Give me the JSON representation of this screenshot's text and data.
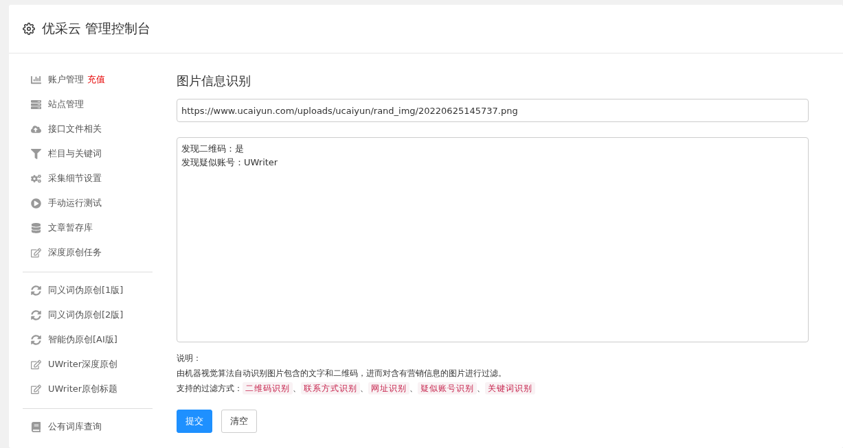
{
  "header": {
    "title": "优采云 管理控制台"
  },
  "sidebar": {
    "groups": [
      {
        "items": [
          {
            "label": "账户管理",
            "badge": "充值"
          },
          {
            "label": "站点管理"
          },
          {
            "label": "接口文件相关"
          },
          {
            "label": "栏目与关键词"
          },
          {
            "label": "采集细节设置"
          },
          {
            "label": "手动运行测试"
          },
          {
            "label": "文章暂存库"
          },
          {
            "label": "深度原创任务"
          }
        ]
      },
      {
        "items": [
          {
            "label": "同义词伪原创[1版]"
          },
          {
            "label": "同义词伪原创[2版]"
          },
          {
            "label": "智能伪原创[AI版]"
          },
          {
            "label": "UWriter深度原创"
          },
          {
            "label": "UWriter原创标题"
          }
        ]
      },
      {
        "items": [
          {
            "label": "公有词库查询"
          }
        ]
      }
    ]
  },
  "main": {
    "title": "图片信息识别",
    "url_field": {
      "value": "https://www.ucaiyun.com/uploads/ucaiyun/rand_img/20220625145737.png"
    },
    "result_box": {
      "lines": [
        "发现二维码：是",
        "发现疑似账号：UWriter"
      ]
    },
    "notes": {
      "heading": "说明：",
      "description": "由机器视觉算法自动识别图片包含的文字和二维码，进而对含有营销信息的图片进行过滤。",
      "methods_label": "支持的过滤方式：",
      "methods": [
        "二维码识别",
        "联系方式识别",
        "网址识别",
        "疑似账号识别",
        "关键词识别"
      ],
      "separator": "、"
    },
    "buttons": [
      {
        "kind": "primary",
        "label": "提交"
      },
      {
        "kind": "default",
        "label": "清空"
      }
    ]
  }
}
